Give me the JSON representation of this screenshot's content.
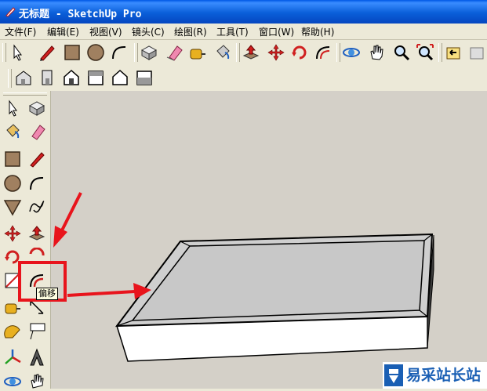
{
  "window": {
    "title": "无标题 - SketchUp Pro"
  },
  "menubar": {
    "items": [
      {
        "label": "文件(F)"
      },
      {
        "label": "编辑(E)"
      },
      {
        "label": "视图(V)"
      },
      {
        "label": "镜头(C)"
      },
      {
        "label": "绘图(R)"
      },
      {
        "label": "工具(T)"
      },
      {
        "label": "窗口(W)"
      },
      {
        "label": "帮助(H)"
      }
    ]
  },
  "toolbar": {
    "tools": [
      "select-icon",
      "pencil-icon",
      "rectangle-icon",
      "circle-icon",
      "arc-icon",
      "make-component-icon",
      "eraser-icon",
      "tape-measure-icon",
      "paint-bucket-icon",
      "push-pull-icon",
      "move-icon",
      "rotate-icon",
      "offset-icon",
      "orbit-icon",
      "pan-icon",
      "zoom-icon",
      "zoom-extents-icon",
      "previous-view-icon",
      "next-view-icon"
    ],
    "views": [
      "iso-view-icon",
      "right-view-icon",
      "front-view-icon",
      "top-view-icon",
      "back-view-icon",
      "left-view-icon"
    ]
  },
  "tooltip": {
    "text": "偏移"
  },
  "colors": {
    "annotation": "#e8141c",
    "viewport": "#d4d0c8",
    "titlebar": "#0a5fd9"
  },
  "watermark": {
    "brand": "易采站长站"
  }
}
